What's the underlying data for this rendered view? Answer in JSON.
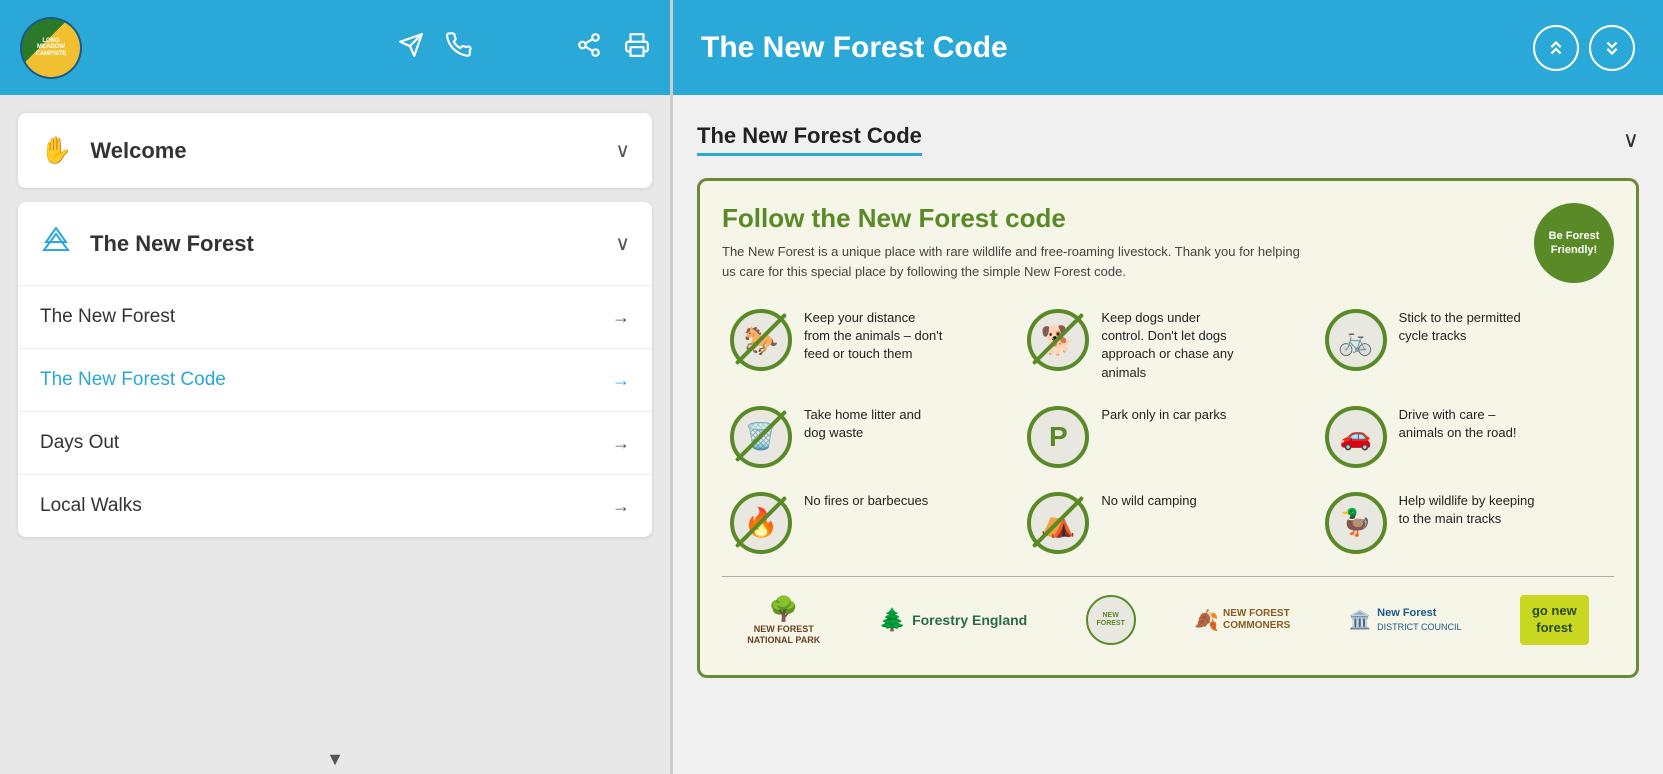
{
  "left": {
    "header": {
      "logo_text": "LONG\nMEADOW\nCAMPSITE"
    },
    "nav_sections": [
      {
        "id": "welcome",
        "icon": "✋",
        "title": "Welcome",
        "expanded": false,
        "items": []
      },
      {
        "id": "new-forest",
        "icon": "⛰️",
        "title": "The New Forest",
        "expanded": true,
        "items": [
          {
            "label": "The New Forest",
            "active": false
          },
          {
            "label": "The New Forest Code",
            "active": true
          },
          {
            "label": "Days Out",
            "active": false
          },
          {
            "label": "Local Walks",
            "active": false
          }
        ]
      }
    ],
    "scroll_down_arrow": "▼"
  },
  "right": {
    "header": {
      "title": "The New Forest Code",
      "up_arrow": "⌃⌃",
      "down_arrow": "⌄⌄"
    },
    "section": {
      "title": "The New Forest Code",
      "chevron": "∨"
    },
    "forest_code": {
      "heading": "Follow the New Forest code",
      "description": "The New Forest is a unique place with rare wildlife and free-roaming livestock. Thank you for helping us care for this special place by following the simple New Forest code.",
      "badge_line1": "Be Forest",
      "badge_line2": "Friendly!",
      "rules": [
        {
          "icon": "🐎",
          "crossed": true,
          "text": "Keep your distance from the animals – don't feed or touch them"
        },
        {
          "icon": "🐕",
          "crossed": true,
          "text": "Keep dogs under control. Don't let dogs approach or chase any animals"
        },
        {
          "icon": "🚲",
          "crossed": false,
          "text": "Stick to the permitted cycle tracks"
        },
        {
          "icon": "🗑️",
          "crossed": true,
          "text": "Take home litter and dog waste"
        },
        {
          "icon": "P",
          "crossed": false,
          "text": "Park only in car parks"
        },
        {
          "icon": "🚗",
          "crossed": false,
          "text": "Drive with care – animals on the road!"
        },
        {
          "icon": "🔥",
          "crossed": true,
          "text": "No fires or barbecues"
        },
        {
          "icon": "⛺",
          "crossed": true,
          "text": "No wild camping"
        },
        {
          "icon": "🦆",
          "crossed": false,
          "text": "Help wildlife by keeping to the main tracks"
        }
      ],
      "logos": [
        {
          "id": "nfnp",
          "label": "NEW FOREST\nNATIONAL PARK"
        },
        {
          "id": "forestry",
          "label": "Forestry England"
        },
        {
          "id": "nfc",
          "label": "NEW FOREST\nCOMMONERS"
        },
        {
          "id": "nfdc",
          "label": "New Forest\nDISTRICT COUNCIL"
        },
        {
          "id": "gonf",
          "label": "go new\nforest"
        }
      ]
    }
  }
}
